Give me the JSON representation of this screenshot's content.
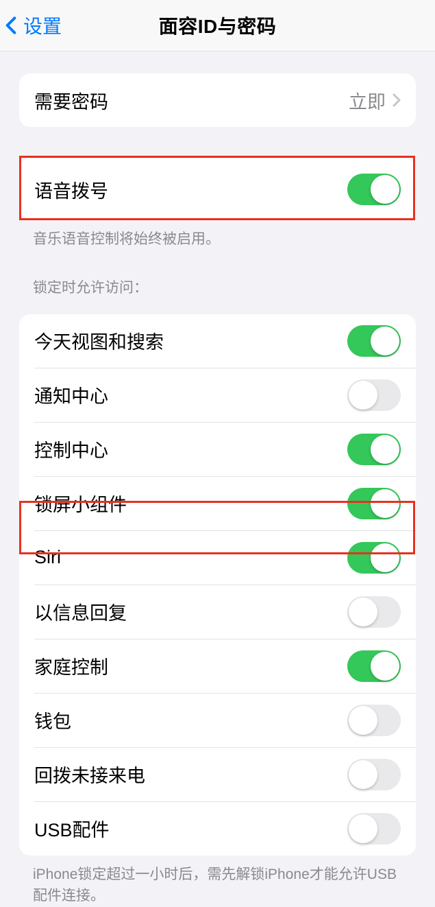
{
  "header": {
    "back_label": "设置",
    "title": "面容ID与密码"
  },
  "passcode": {
    "label": "需要密码",
    "value": "立即"
  },
  "voice_dial": {
    "label": "语音拨号",
    "on": true,
    "footer": "音乐语音控制将始终被启用。"
  },
  "lock_section": {
    "header": "锁定时允许访问：",
    "items": [
      {
        "label": "今天视图和搜索",
        "on": true
      },
      {
        "label": "通知中心",
        "on": false
      },
      {
        "label": "控制中心",
        "on": true
      },
      {
        "label": "锁屏小组件",
        "on": true
      },
      {
        "label": "Siri",
        "on": true
      },
      {
        "label": "以信息回复",
        "on": false
      },
      {
        "label": "家庭控制",
        "on": true
      },
      {
        "label": "钱包",
        "on": false
      },
      {
        "label": "回拨未接来电",
        "on": false
      },
      {
        "label": "USB配件",
        "on": false
      }
    ],
    "footer": "iPhone锁定超过一小时后，需先解锁iPhone才能允许USB配件连接。"
  }
}
